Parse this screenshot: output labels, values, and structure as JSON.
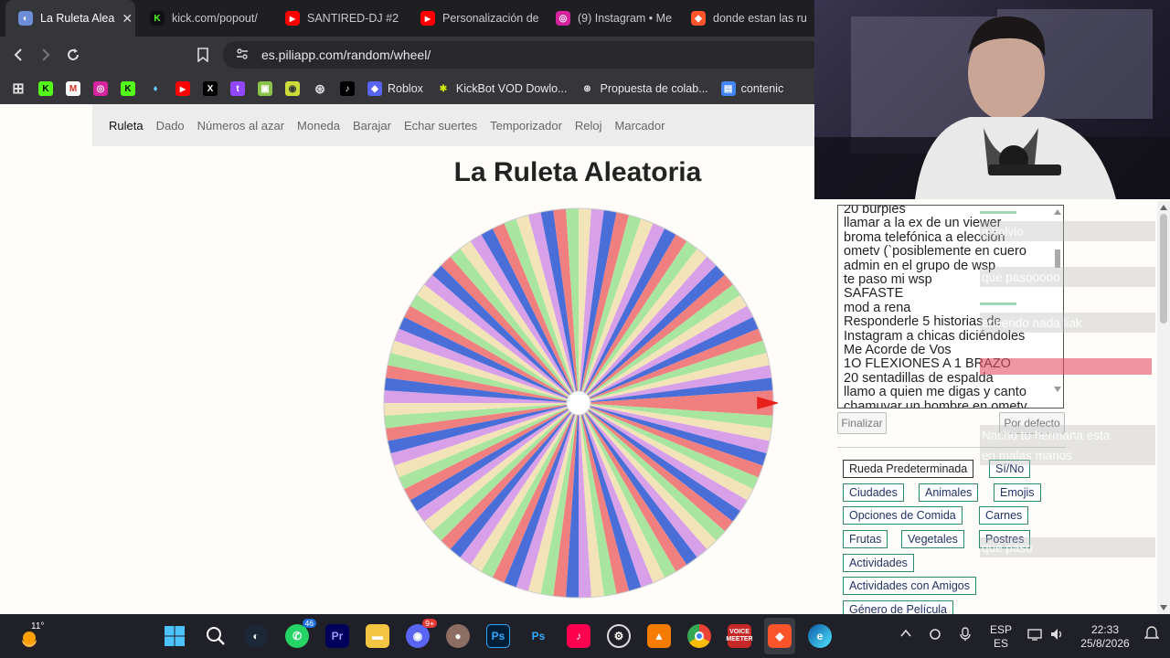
{
  "tabs": [
    {
      "title": "La Ruleta Alea",
      "color": "#6a8fd8",
      "glyph": "◐"
    },
    {
      "title": "kick.com/popout/",
      "color": "#53fc18",
      "glyph": "K"
    },
    {
      "title": "SANTIRED-DJ #2",
      "color": "#ff0000",
      "glyph": "▶"
    },
    {
      "title": "Personalización de",
      "color": "#ff0000",
      "glyph": "▶"
    },
    {
      "title": "(9) Instagram • Me",
      "color": "#d6249f",
      "glyph": "◎"
    },
    {
      "title": "donde estan las ru",
      "color": "#fb542b",
      "glyph": "◆"
    }
  ],
  "active_tab_close": "✕",
  "url": "es.piliapp.com/random/wheel/",
  "bookmarks": [
    "Roblox",
    "KickBot VOD Dowlo...",
    "Propuesta de colab...",
    "contenic"
  ],
  "site_nav": [
    "Ruleta",
    "Dado",
    "Números al azar",
    "Moneda",
    "Barajar",
    "Echar suertes",
    "Temporizador",
    "Reloj",
    "Marcador"
  ],
  "page_title": "La Ruleta Aleatoria",
  "entries": [
    "20 burpies",
    "llamar a la ex de un viewer",
    "broma telefónica a elección",
    "ometv (`posiblemente en cuero",
    "admin en el grupo de wsp",
    "te paso mi wsp",
    "SAFASTE",
    "mod a rena",
    "Responderle 5 historias de",
    "Instagram a chicas diciéndoles",
    "Me Acorde de Vos",
    "1O FLEXIONES A 1 BRAZO",
    "20 sentadillas de espalda",
    "llamo a quien me digas y canto",
    "chamuyar un hombre en ometv"
  ],
  "buttons": {
    "finalize": "Finalizar",
    "default": "Por defecto"
  },
  "presets": [
    "Rueda Predeterminada",
    "Sí/No",
    "Ciudades",
    "Animales",
    "Emojis",
    "Opciones de Comida",
    "Carnes",
    "Frutas",
    "Vegetales",
    "Postres",
    "Actividades",
    "Actividades con Amigos",
    "Género de Película"
  ],
  "chat": [
    "a volvio",
    "que pasooooo",
    "entiendo nada liak",
    "Nacho tu hermana esta",
    "en malas manos",
    "que paso"
  ],
  "wheel": {
    "segments": 96,
    "colors": [
      "#f08080",
      "#a8e6a0",
      "#f2e4b8",
      "#d8a0e8",
      "#4a6ed8"
    ],
    "pointer_color": "#e8201c"
  },
  "taskbar": {
    "weather": "11°",
    "whatsapp_badge": "46",
    "discord_badge": "9+",
    "lang": "ESP",
    "region": "ES",
    "time": "22:33",
    "date": "25/8/2026",
    "voicemeeter": "VOICE MEETER"
  }
}
